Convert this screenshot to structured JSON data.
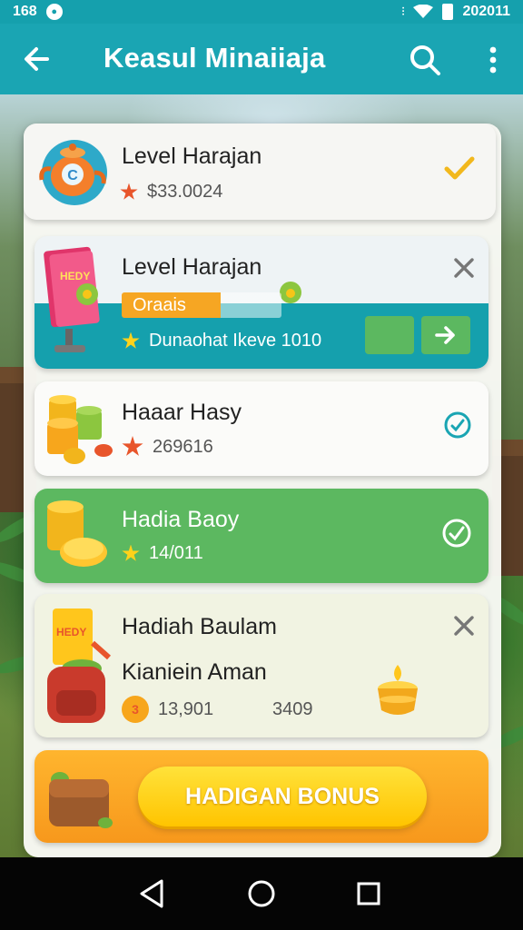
{
  "status_bar": {
    "left_text": "168",
    "right_text": "202011"
  },
  "app_bar": {
    "title": "Keasul Minaiiaja"
  },
  "items": [
    {
      "name": "Level Harajan",
      "value": "$33.0024"
    },
    {
      "name": "Level Harajan",
      "chip": "Oraais",
      "detail": "Dunaohat Ikeve 1010"
    },
    {
      "name": "Haaar Hasy",
      "value": "269616"
    },
    {
      "name": "Hadia Baoy",
      "value": "14/011"
    },
    {
      "name": "Hadiah Baulam",
      "subtitle": "Kianiein Aman",
      "value": "13,901",
      "value2": "3409",
      "badge": "3"
    }
  ],
  "bonus_button": {
    "label": "HADIGAN BONUS"
  },
  "colors": {
    "teal": "#15a0ad",
    "green": "#5cb860",
    "orange": "#f7981c",
    "yellow": "#ffd21a",
    "check": "#f2b81c"
  },
  "icons": {
    "back": "arrow-left-icon",
    "search": "search-icon",
    "more": "more-vert-icon",
    "check": "check-icon",
    "close": "close-icon",
    "check_circle": "check-circle-icon",
    "arrow_forward": "arrow-right-icon"
  }
}
